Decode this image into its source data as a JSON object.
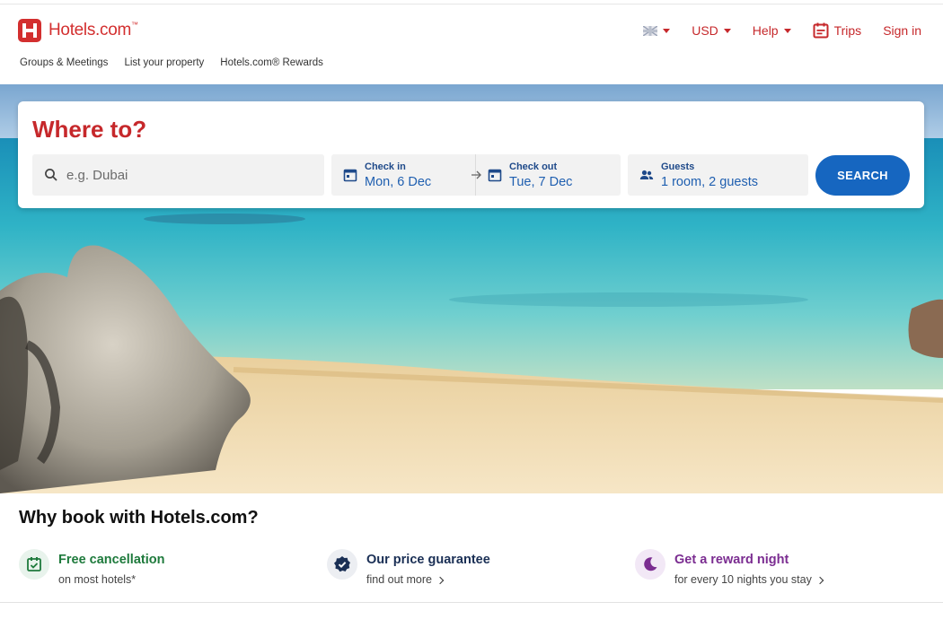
{
  "brand": {
    "name": "Hotels.com",
    "tm": "™",
    "color": "#d32f2f"
  },
  "topnav": {
    "flag_icon": "uk-flag-icon",
    "currency": "USD",
    "help": "Help",
    "trips": "Trips",
    "sign_in": "Sign in"
  },
  "subnav": {
    "items": [
      "Groups & Meetings",
      "List your property",
      "Hotels.com® Rewards"
    ]
  },
  "search": {
    "title": "Where to?",
    "destination_placeholder": "e.g. Dubai",
    "check_in_label": "Check in",
    "check_in_value": "Mon, 6 Dec",
    "check_out_label": "Check out",
    "check_out_value": "Tue, 7 Dec",
    "guests_label": "Guests",
    "guests_value": "1 room, 2 guests",
    "button": "SEARCH"
  },
  "why": {
    "title": "Why book with Hotels.com?",
    "benefits": [
      {
        "title": "Free cancellation",
        "subtitle": "on most hotels*",
        "icon": "calendar-check-icon",
        "color": "#1e7a3c"
      },
      {
        "title": "Our price guarantee",
        "subtitle": "find out more",
        "icon": "badge-check-icon",
        "color": "#1a2f55"
      },
      {
        "title": "Get a reward night",
        "subtitle": "for every 10 nights you stay",
        "icon": "moon-icon",
        "color": "#7b2d91"
      }
    ]
  },
  "colors": {
    "accent_red": "#c6282b",
    "primary_blue": "#1666c0",
    "label_blue": "#1f4a8a"
  }
}
